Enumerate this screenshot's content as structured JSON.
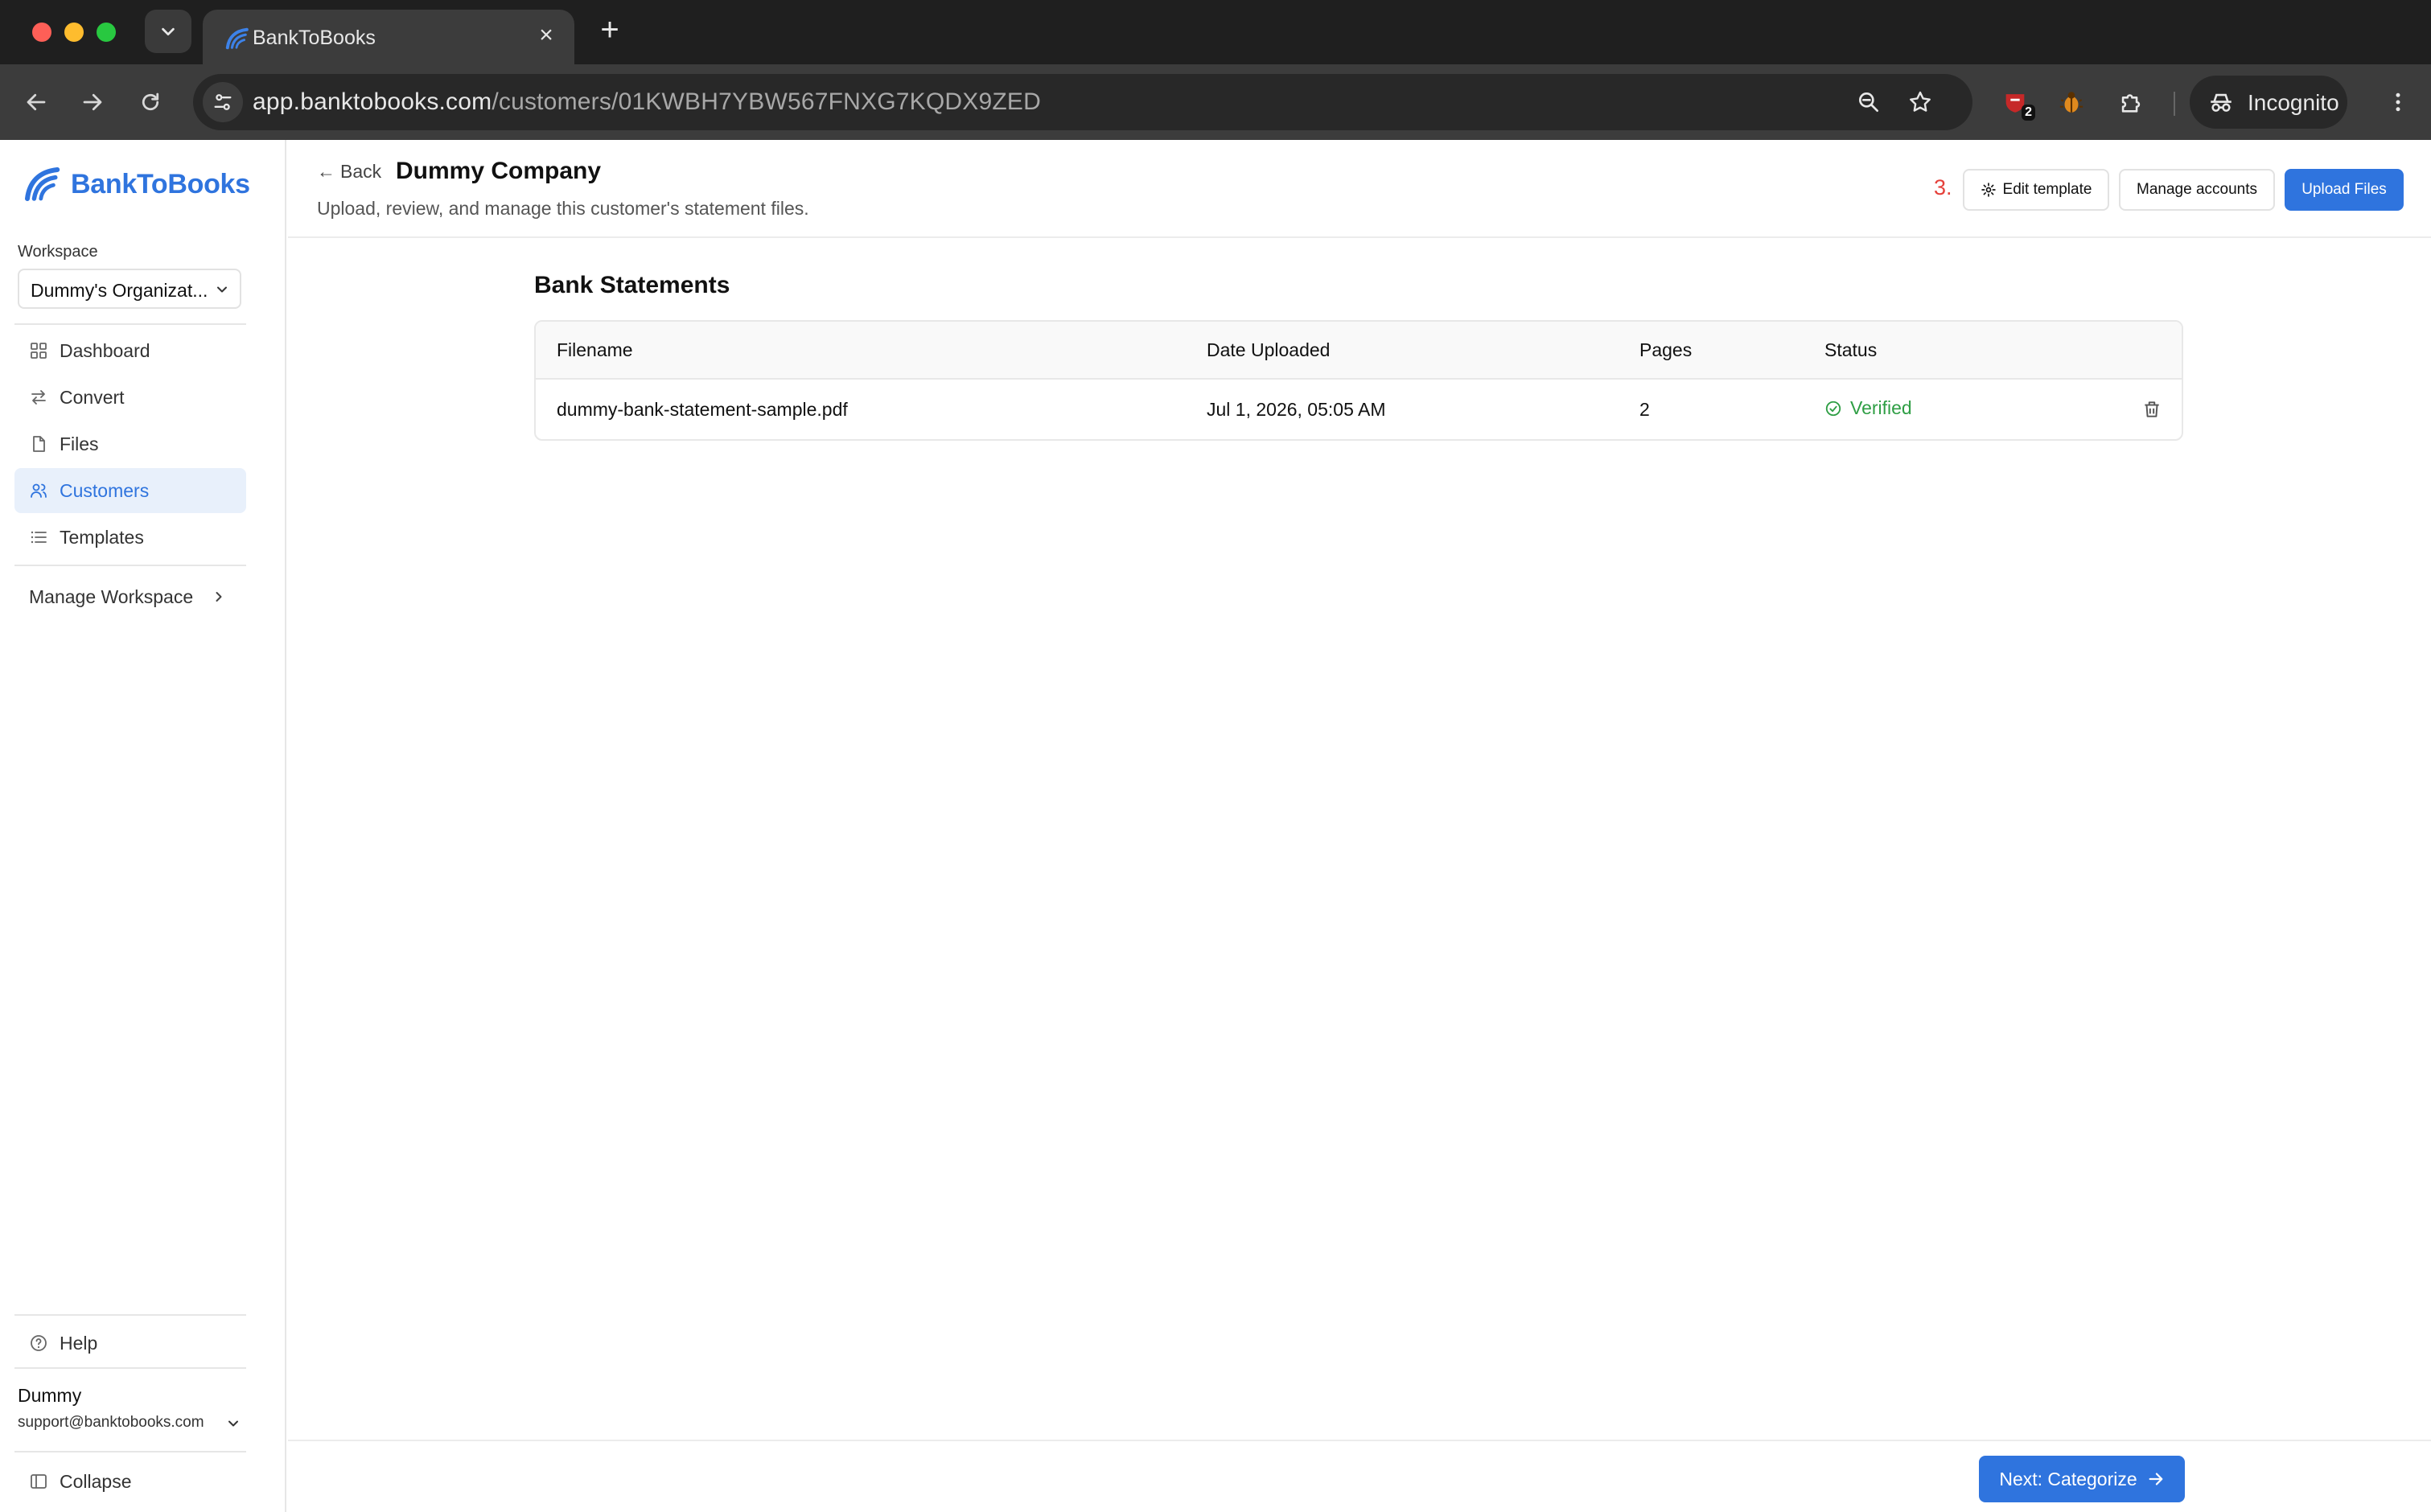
{
  "browser": {
    "tab_title": "BankToBooks",
    "url_host": "app.banktobooks.com",
    "url_path": "/customers/01KWBH7YBW567FNXG7KQDX9ZED",
    "extension_badge": "2",
    "incognito_label": "Incognito"
  },
  "sidebar": {
    "brand": "BankToBooks",
    "workspace_label": "Workspace",
    "workspace_value": "Dummy's Organizat...",
    "items": [
      {
        "label": "Dashboard",
        "icon": "grid-icon"
      },
      {
        "label": "Convert",
        "icon": "arrows-swap-icon"
      },
      {
        "label": "Files",
        "icon": "file-icon"
      },
      {
        "label": "Customers",
        "icon": "users-icon",
        "active": true
      },
      {
        "label": "Templates",
        "icon": "list-icon"
      }
    ],
    "manage_workspace": "Manage Workspace",
    "help": "Help",
    "user_name": "Dummy",
    "user_email": "support@banktobooks.com",
    "collapse": "Collapse"
  },
  "header": {
    "back_label": "Back",
    "title": "Dummy Company",
    "subtitle": "Upload, review, and manage this customer's statement files.",
    "step_marker": "3.",
    "edit_template": "Edit template",
    "manage_accounts": "Manage accounts",
    "upload_files": "Upload Files"
  },
  "statements": {
    "title": "Bank Statements",
    "columns": [
      "Filename",
      "Date Uploaded",
      "Pages",
      "Status"
    ],
    "rows": [
      {
        "filename": "dummy-bank-statement-sample.pdf",
        "date_uploaded": "Jul 1, 2026, 05:05 AM",
        "pages": "2",
        "status": "Verified"
      }
    ]
  },
  "footer": {
    "next_label": "Next: Categorize"
  },
  "colors": {
    "accent": "#2f74de",
    "verified": "#2e9e44",
    "step_marker": "#e5413b"
  }
}
